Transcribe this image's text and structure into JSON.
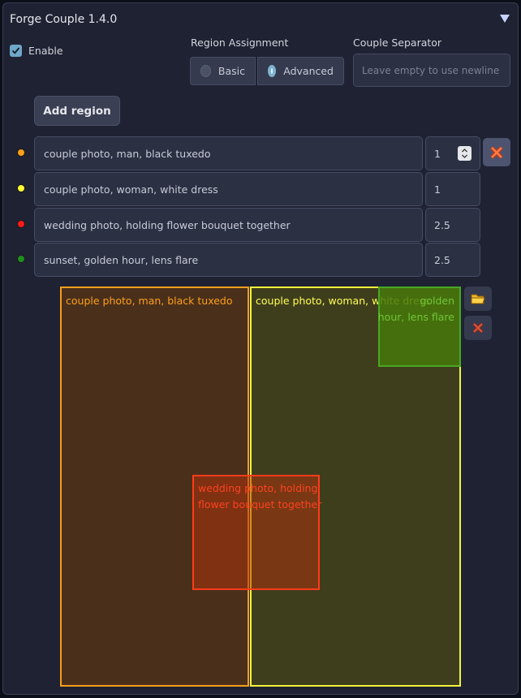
{
  "header": {
    "title": "Forge Couple 1.4.0",
    "collapse_icon": "triangle-down-icon"
  },
  "enable": {
    "label": "Enable",
    "checked": true
  },
  "region_assignment": {
    "label": "Region Assignment",
    "options": [
      {
        "label": "Basic",
        "checked": false
      },
      {
        "label": "Advanced",
        "checked": true
      }
    ]
  },
  "couple_separator": {
    "label": "Couple Separator",
    "placeholder": "Leave empty to use newline",
    "value": ""
  },
  "add_region": {
    "label": "Add region"
  },
  "regions": [
    {
      "prompt": "couple photo, man, black tuxedo",
      "weight": "1",
      "color": "#ff9f1a"
    },
    {
      "prompt": "couple photo, woman, white dress",
      "weight": "1",
      "color": "#ffff33"
    },
    {
      "prompt": "wedding photo, holding flower bouquet together",
      "weight": "2.5",
      "color": "#ff1a1a"
    },
    {
      "prompt": "sunset, golden hour, lens flare",
      "weight": "2.5",
      "color": "#1f8f1f"
    }
  ],
  "canvas": {
    "labels": {
      "r0": "couple photo, man, black tuxedo",
      "r1": "couple photo, woman, white dress",
      "r2_line1": "wedding photo, holding",
      "r2_line2": "flower bouquet together",
      "r3_line1": "golden",
      "r3_line2": "hour, lens flare"
    },
    "icons": {
      "load": "folder-icon",
      "clear": "close-icon"
    }
  }
}
